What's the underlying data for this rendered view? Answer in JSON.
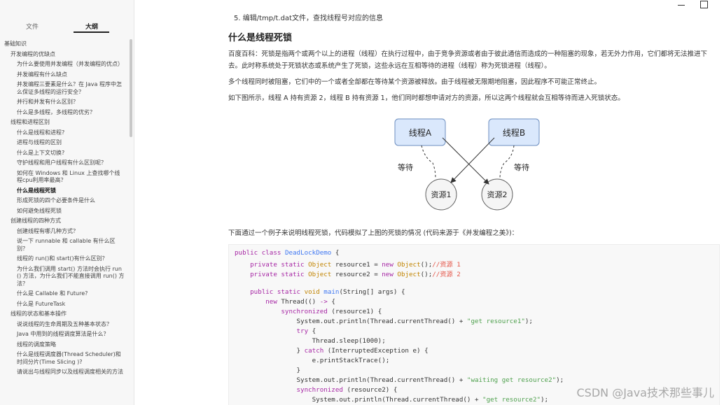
{
  "window": {
    "minimize_icon": "minimize-icon",
    "maximize_icon": "maximize-icon"
  },
  "sidebar": {
    "tabs": [
      {
        "label": "文件",
        "active": false
      },
      {
        "label": "大纲",
        "active": true
      }
    ],
    "outline": [
      {
        "label": "基础知识",
        "level": 1
      },
      {
        "label": "开发编程的优缺点",
        "level": 2
      },
      {
        "label": "为什么要使用并发编程（并发编程的优点）",
        "level": 3
      },
      {
        "label": "并发编程有什么缺点",
        "level": 3
      },
      {
        "label": "并发编程三要素是什么？在 Java 程序中怎么保证多线程的运行安全？",
        "level": 3
      },
      {
        "label": "并行和并发有什么区别？",
        "level": 3
      },
      {
        "label": "什么是多线程，多线程的优劣？",
        "level": 3
      },
      {
        "label": "线程和进程区别",
        "level": 2
      },
      {
        "label": "什么是线程和进程?",
        "level": 3
      },
      {
        "label": "进程与线程的区别",
        "level": 3
      },
      {
        "label": "什么是上下文切换?",
        "level": 3
      },
      {
        "label": "守护线程和用户线程有什么区别呢？",
        "level": 3
      },
      {
        "label": "如何在 Windows 和 Linux 上查找哪个线程cpu利用率最高？",
        "level": 3
      },
      {
        "label": "什么是线程死锁",
        "level": 3,
        "active": true
      },
      {
        "label": "形成死锁的四个必要条件是什么",
        "level": 3
      },
      {
        "label": "如何避免线程死锁",
        "level": 3
      },
      {
        "label": "创建线程的四种方式",
        "level": 2
      },
      {
        "label": "创建线程有哪几种方式？",
        "level": 3
      },
      {
        "label": "说一下 runnable 和 callable 有什么区别？",
        "level": 3
      },
      {
        "label": "线程的 run()和 start()有什么区别？",
        "level": 3
      },
      {
        "label": "为什么我们调用 start() 方法时会执行 run() 方法，为什么我们不能直接调用 run() 方法？",
        "level": 3
      },
      {
        "label": "什么是 Callable 和 Future?",
        "level": 3
      },
      {
        "label": "什么是 FutureTask",
        "level": 3
      },
      {
        "label": "线程的状态和基本操作",
        "level": 2
      },
      {
        "label": "说说线程的生命周期及五种基本状态？",
        "level": 3
      },
      {
        "label": "Java 中用到的线程调度算法是什么？",
        "level": 3
      },
      {
        "label": "线程的调度策略",
        "level": 3
      },
      {
        "label": "什么是线程调度器(Thread Scheduler)和时间分片(Time Slicing )?",
        "level": 3
      },
      {
        "label": "请说出与线程同步以及线程调度相关的方法",
        "level": 3
      }
    ]
  },
  "content": {
    "top_list_item": "5. 编辑/tmp/t.dat文件，查找线程号对应的信息",
    "heading": "什么是线程死锁",
    "para1": "百度百科：死锁是指两个或两个以上的进程（线程）在执行过程中，由于竞争资源或者由于彼此通信而造成的一种阻塞的现象，若无外力作用，它们都将无法推进下去。此时称系统处于死锁状态或系统产生了死锁，这些永远在互相等待的进程（线程）称为死锁进程（线程）。",
    "para2": "多个线程同时被阻塞，它们中的一个或者全部都在等待某个资源被释放。由于线程被无限期地阻塞，因此程序不可能正常终止。",
    "para3": "如下图所示，线程 A 持有资源 2，线程 B 持有资源 1，他们同时都想申请对方的资源，所以这两个线程就会互相等待而进入死锁状态。",
    "para4": "下面通过一个例子来说明线程死锁，代码模拟了上图的死锁的情况 (代码来源于《并发编程之美》)："
  },
  "diagram": {
    "thread_a": "线程A",
    "thread_b": "线程B",
    "resource_1": "资源1",
    "resource_2": "资源2",
    "wait_left": "等待",
    "wait_right": "等待"
  },
  "code": {
    "l1_a": "public class",
    "l1_b": "DeadLockDemo",
    "l1_c": " {",
    "l2_a": "private static",
    "l2_b": "Object",
    "l2_c": " resource1 = ",
    "l2_d": "new",
    "l2_e": "Object",
    "l2_f": "();",
    "l2_g": "//资源 1",
    "l3_a": "private static",
    "l3_b": "Object",
    "l3_c": " resource2 = ",
    "l3_d": "new",
    "l3_e": "Object",
    "l3_f": "();",
    "l3_g": "//资源 2",
    "l5_a": "public static",
    "l5_b": "void",
    "l5_c": "main",
    "l5_d": "(String[] args) {",
    "l6_a": "new",
    "l6_b": " Thread(() ",
    "l6_c": "->",
    "l6_d": " {",
    "l7_a": "synchronized",
    "l7_b": " (resource1) {",
    "l8_a": "System.out.println(Thread.currentThread() + ",
    "l8_b": "\"get resource1\"",
    "l8_c": ");",
    "l9_a": "try",
    "l9_b": " {",
    "l10": "Thread.sleep(1000);",
    "l11_a": "} ",
    "l11_b": "catch",
    "l11_c": " (InterruptedException e) {",
    "l12": "e.printStackTrace();",
    "l13": "}",
    "l14_a": "System.out.println(Thread.currentThread() + ",
    "l14_b": "\"waiting get resource2\"",
    "l14_c": ");",
    "l15_a": "synchronized",
    "l15_b": " (resource2) {",
    "l16_a": "System.out.println(Thread.currentThread() + ",
    "l16_b": "\"get resource2\"",
    "l16_c": ");"
  },
  "watermark": "CSDN @Java技术那些事儿"
}
